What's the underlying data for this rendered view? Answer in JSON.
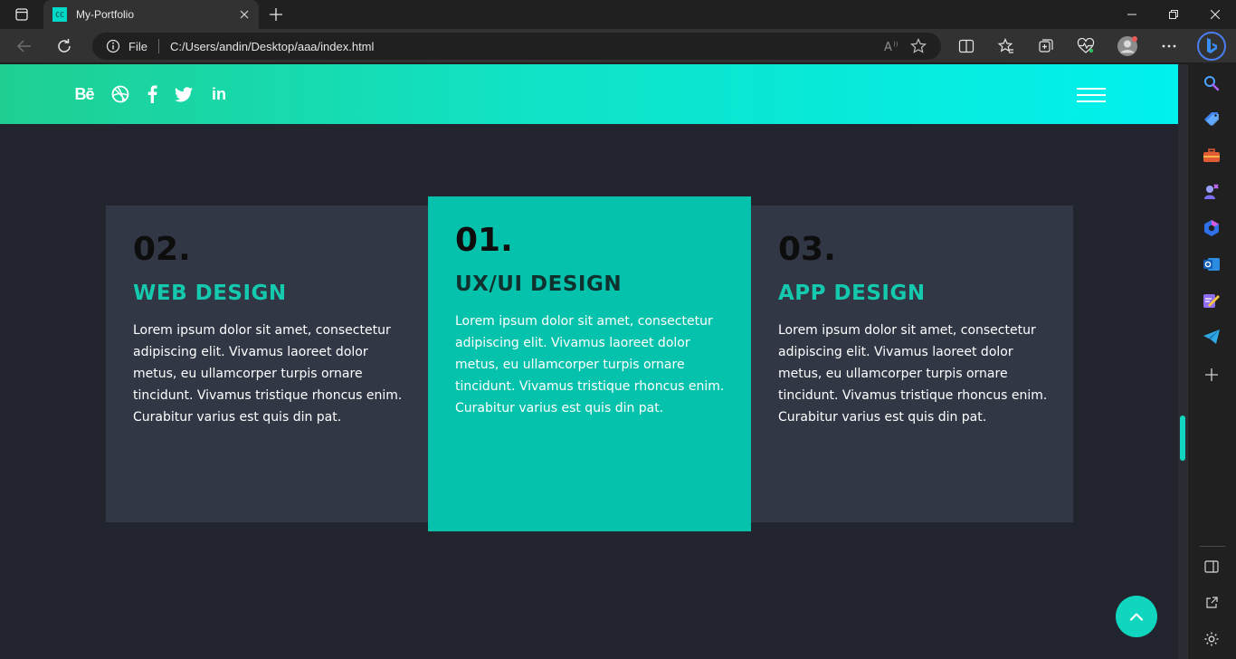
{
  "browser": {
    "tab_title": "My-Portfolio",
    "favicon_text": "CC",
    "address_scheme": "File",
    "address_url": "C:/Users/andin/Desktop/aaa/index.html"
  },
  "site": {
    "header_gradient": [
      "#1fcf92",
      "#00f1ee"
    ],
    "social_icons": [
      "behance-icon",
      "dribbble-icon",
      "facebook-icon",
      "twitter-icon",
      "linkedin-icon"
    ],
    "behance_label": "Bē",
    "linkedin_label": "in",
    "accent_color": "#05c2ac"
  },
  "services": [
    {
      "number": "02.",
      "title": "WEB DESIGN",
      "text": "Lorem ipsum dolor sit amet, consectetur adipiscing elit. Vivamus laoreet dolor metus, eu ullamcorper turpis ornare tincidunt. Vivamus tristique rhoncus enim. Curabitur varius est quis din pat."
    },
    {
      "number": "01.",
      "title": "UX/UI DESIGN",
      "text": "Lorem ipsum dolor sit amet, consectetur adipiscing elit. Vivamus laoreet dolor metus, eu ullamcorper turpis ornare tincidunt. Vivamus tristique rhoncus enim. Curabitur varius est quis din pat."
    },
    {
      "number": "03.",
      "title": "APP DESIGN",
      "text": "Lorem ipsum dolor sit amet, consectetur adipiscing elit. Vivamus laoreet dolor metus, eu ullamcorper turpis ornare tincidunt. Vivamus tristique rhoncus enim. Curabitur varius est quis din pat."
    }
  ]
}
